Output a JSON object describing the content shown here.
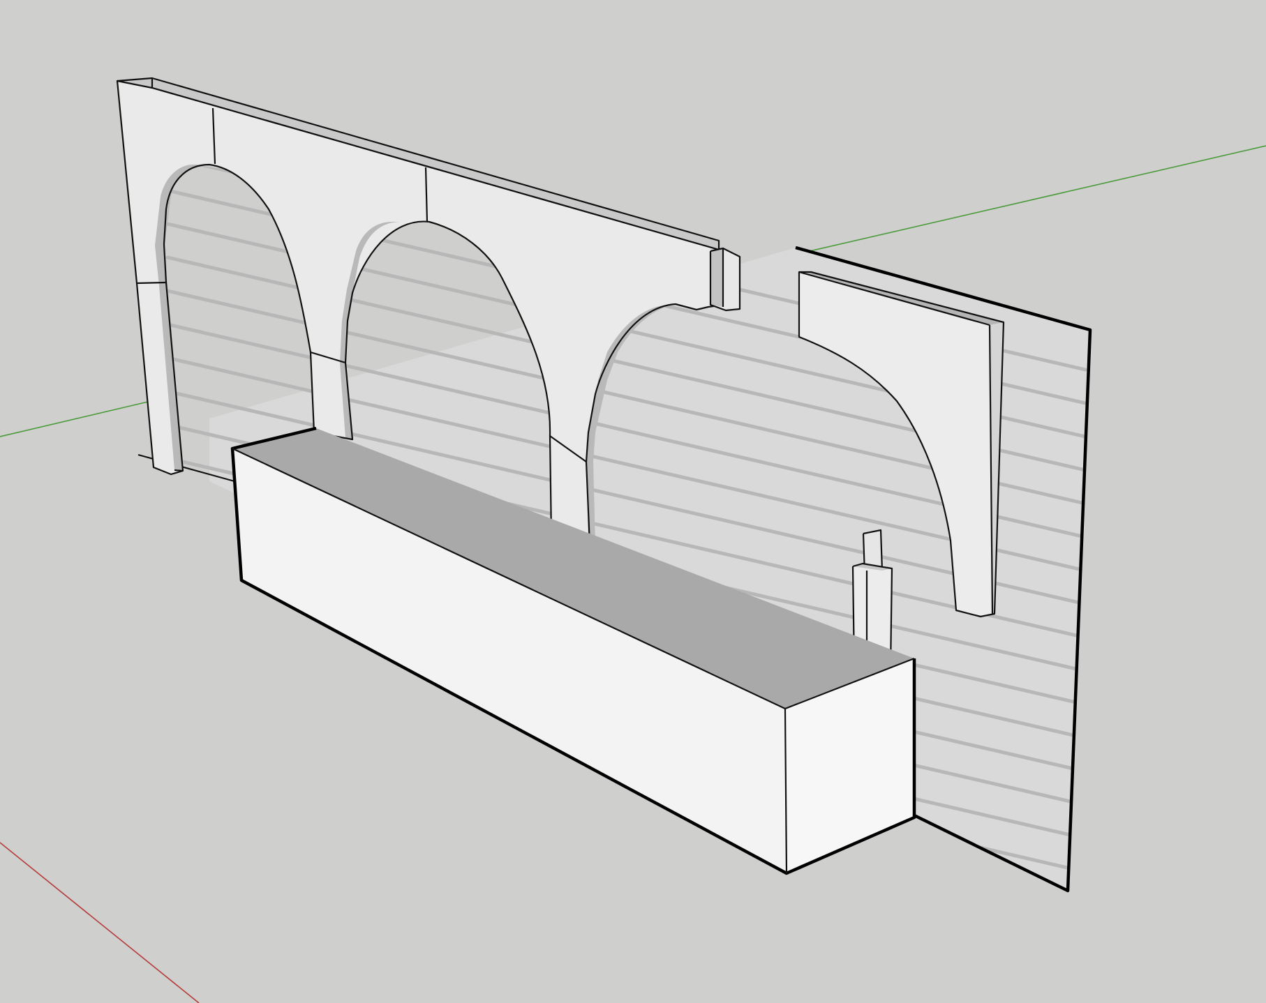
{
  "viewport": {
    "background_color": "#cfcfcd",
    "axis_colors": {
      "green_axis": "#4a9a3a",
      "red_axis": "#b43a3a"
    },
    "model_colors": {
      "face_light": "#eaeaea",
      "face_white": "#f3f3f3",
      "face_shaded": "#c9c9c9",
      "face_top": "#a9a9a9",
      "siding_panel": "#d9d9d9",
      "edge": "#111111"
    }
  }
}
